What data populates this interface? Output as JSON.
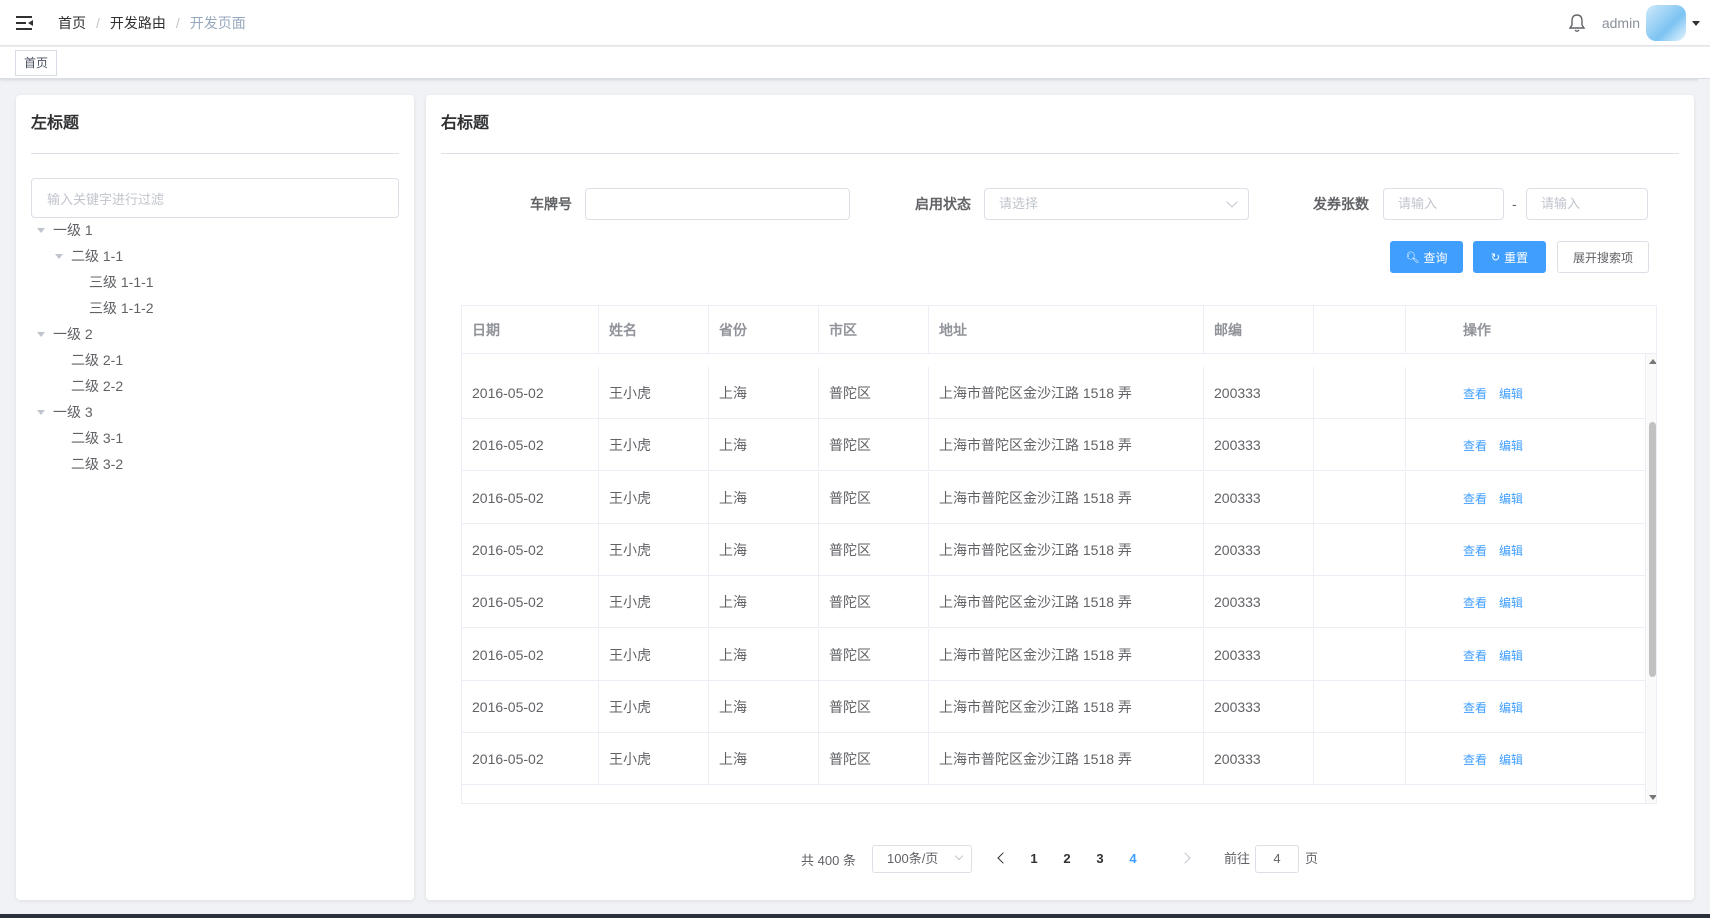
{
  "header": {
    "breadcrumb": [
      "首页",
      "开发路由",
      "开发页面"
    ],
    "username": "admin"
  },
  "tags": {
    "active": "首页"
  },
  "left": {
    "title": "左标题",
    "filter_placeholder": "输入关键字进行过滤",
    "tree": [
      {
        "label": "一级 1",
        "level": 0,
        "expanded": true
      },
      {
        "label": "二级 1-1",
        "level": 1,
        "expanded": true
      },
      {
        "label": "三级 1-1-1",
        "level": 2,
        "expanded": false
      },
      {
        "label": "三级 1-1-2",
        "level": 2,
        "expanded": false
      },
      {
        "label": "一级 2",
        "level": 0,
        "expanded": true
      },
      {
        "label": "二级 2-1",
        "level": 1,
        "expanded": false
      },
      {
        "label": "二级 2-2",
        "level": 1,
        "expanded": false
      },
      {
        "label": "一级 3",
        "level": 0,
        "expanded": true
      },
      {
        "label": "二级 3-1",
        "level": 1,
        "expanded": false
      },
      {
        "label": "二级 3-2",
        "level": 1,
        "expanded": false
      }
    ]
  },
  "right": {
    "title": "右标题",
    "search": {
      "plate_label": "车牌号",
      "plate_value": "",
      "status_label": "启用状态",
      "status_placeholder": "请选择",
      "count_label": "发券张数",
      "count_from_placeholder": "请输入",
      "count_to_placeholder": "请输入",
      "range_sep": "-",
      "query_button": "查询",
      "reset_button": "重置",
      "expand_button": "展开搜索项"
    },
    "table": {
      "columns": [
        "日期",
        "姓名",
        "省份",
        "市区",
        "地址",
        "邮编",
        "",
        "操作"
      ],
      "rows": [
        [
          "2016-05-02",
          "王小虎",
          "上海",
          "普陀区",
          "上海市普陀区金沙江路 1518 弄",
          "200333"
        ],
        [
          "2016-05-02",
          "王小虎",
          "上海",
          "普陀区",
          "上海市普陀区金沙江路 1518 弄",
          "200333"
        ],
        [
          "2016-05-02",
          "王小虎",
          "上海",
          "普陀区",
          "上海市普陀区金沙江路 1518 弄",
          "200333"
        ],
        [
          "2016-05-02",
          "王小虎",
          "上海",
          "普陀区",
          "上海市普陀区金沙江路 1518 弄",
          "200333"
        ],
        [
          "2016-05-02",
          "王小虎",
          "上海",
          "普陀区",
          "上海市普陀区金沙江路 1518 弄",
          "200333"
        ],
        [
          "2016-05-02",
          "王小虎",
          "上海",
          "普陀区",
          "上海市普陀区金沙江路 1518 弄",
          "200333"
        ],
        [
          "2016-05-02",
          "王小虎",
          "上海",
          "普陀区",
          "上海市普陀区金沙江路 1518 弄",
          "200333"
        ],
        [
          "2016-05-02",
          "王小虎",
          "上海",
          "普陀区",
          "上海市普陀区金沙江路 1518 弄",
          "200333"
        ]
      ],
      "actions": [
        "查看",
        "编辑"
      ]
    },
    "pagination": {
      "total": "共 400 条",
      "page_size": "100条/页",
      "pages": [
        "1",
        "2",
        "3",
        "4"
      ],
      "current": "4",
      "goto_prefix": "前往",
      "goto_value": "4",
      "goto_suffix": "页"
    }
  },
  "colors": {
    "primary": "#409eff",
    "text": "#606266",
    "border": "#dcdfe6"
  }
}
